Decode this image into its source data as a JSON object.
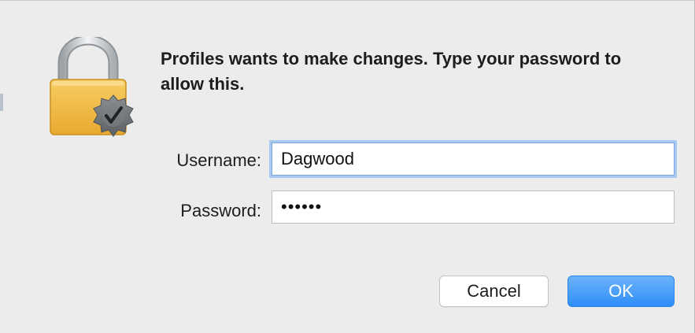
{
  "dialog": {
    "message": "Profiles wants to make changes. Type your password to allow this.",
    "icon": "lock-badge-icon",
    "username_label": "Username:",
    "username_value": "Dagwood",
    "password_label": "Password:",
    "password_value": "••••••",
    "cancel_label": "Cancel",
    "ok_label": "OK"
  },
  "colors": {
    "background": "#ececec",
    "accent": "#2f8ef7",
    "lock_gold": "#f2b947",
    "badge_gray": "#6f7478"
  }
}
